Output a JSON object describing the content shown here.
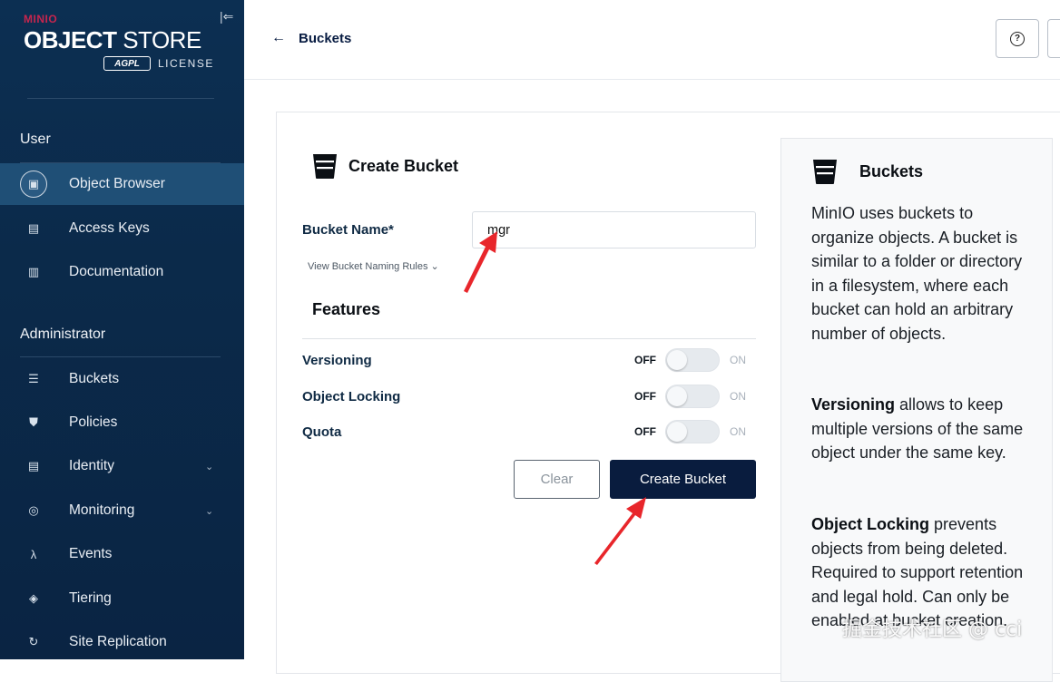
{
  "brand": {
    "product": "MINIO",
    "title_bold": "OBJECT",
    "title_light": " STORE",
    "badge": "AGPL",
    "license": "LICENSE"
  },
  "sidebar": {
    "user_section": "User",
    "admin_section": "Administrator",
    "user_items": [
      {
        "label": "Object Browser",
        "icon": "object-browser-icon",
        "active": true
      },
      {
        "label": "Access Keys",
        "icon": "access-keys-icon"
      },
      {
        "label": "Documentation",
        "icon": "documentation-icon"
      }
    ],
    "admin_items": [
      {
        "label": "Buckets",
        "icon": "buckets-icon"
      },
      {
        "label": "Policies",
        "icon": "policies-icon"
      },
      {
        "label": "Identity",
        "icon": "identity-icon",
        "expandable": true
      },
      {
        "label": "Monitoring",
        "icon": "monitoring-icon",
        "expandable": true
      },
      {
        "label": "Events",
        "icon": "lambda-icon"
      },
      {
        "label": "Tiering",
        "icon": "tiering-icon"
      },
      {
        "label": "Site Replication",
        "icon": "site-replication-icon"
      }
    ]
  },
  "header": {
    "back_label": "Buckets"
  },
  "form": {
    "title": "Create Bucket",
    "bucket_name_label": "Bucket Name*",
    "bucket_name_value": "mgr",
    "naming_rules": "View Bucket Naming Rules",
    "features_title": "Features",
    "features": [
      {
        "label": "Versioning",
        "off": "OFF",
        "on": "ON",
        "enabled": false
      },
      {
        "label": "Object Locking",
        "off": "OFF",
        "on": "ON",
        "enabled": false
      },
      {
        "label": "Quota",
        "off": "OFF",
        "on": "ON",
        "enabled": false
      }
    ],
    "clear_label": "Clear",
    "create_label": "Create Bucket"
  },
  "help": {
    "title": "Buckets",
    "intro": "MinIO uses buckets to organize objects. A bucket is similar to a folder or directory in a filesystem, where each bucket can hold an arbitrary number of objects.",
    "versioning_term": "Versioning",
    "versioning_text": " allows to keep multiple versions of the same object under the same key.",
    "locking_term": "Object Locking",
    "locking_text": " prevents objects from being deleted. Required to support retention and legal hold. Can only be enabled at bucket creation."
  },
  "watermark": "掘金技术社区 @ cci",
  "colors": {
    "sidebar_bg": "#0b2a4a",
    "active_item": "#1f4f76",
    "primary_button": "#091c3e",
    "annotation_arrow": "#e8262b"
  }
}
